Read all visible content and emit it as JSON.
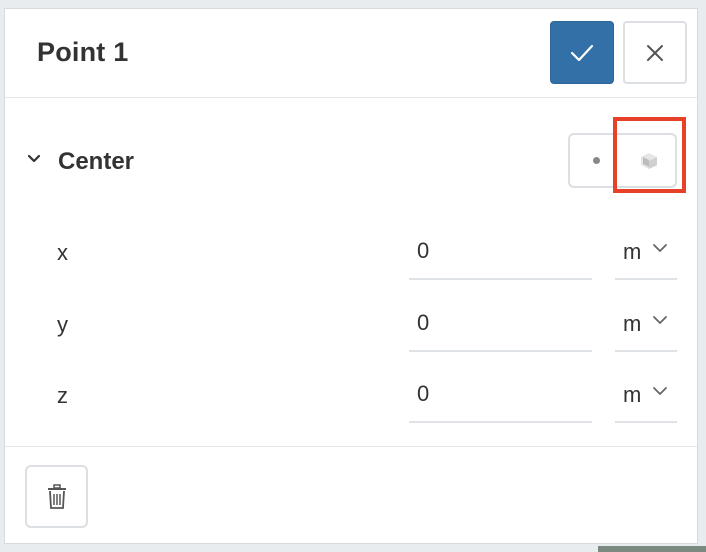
{
  "dialog": {
    "title": "Point 1",
    "confirm_icon": "check-icon",
    "close_icon": "close-icon"
  },
  "section": {
    "label": "Center",
    "expanded": true,
    "toggle_options": [
      "point-mode-icon",
      "pick-from-model-icon"
    ]
  },
  "coordinates": [
    {
      "axis": "x",
      "value": "0",
      "unit": "m"
    },
    {
      "axis": "y",
      "value": "0",
      "unit": "m"
    },
    {
      "axis": "z",
      "value": "0",
      "unit": "m"
    }
  ],
  "footer": {
    "delete_icon": "trash-icon"
  },
  "colors": {
    "primary": "#3470a8",
    "highlight": "#e8412a",
    "border": "#dcdfe3",
    "text": "#333333"
  }
}
